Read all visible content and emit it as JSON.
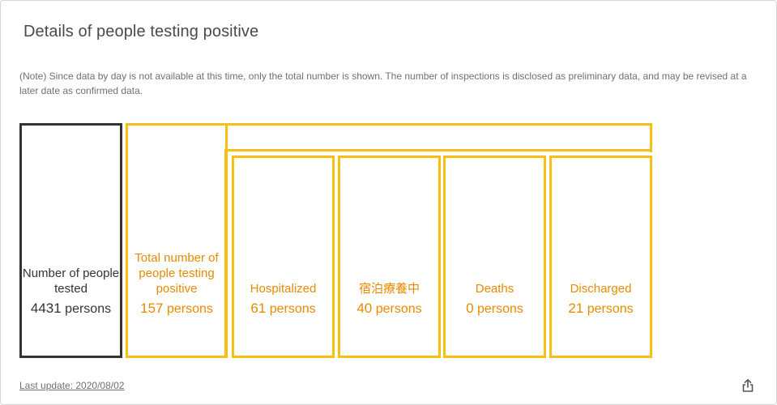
{
  "header": {
    "title": "Details of people testing positive"
  },
  "note": "(Note) Since data by day is not available at this time, only the total number is shown. The number of inspections is disclosed as preliminary data, and may be revised at a later date as confirmed data.",
  "boxes": {
    "tested": {
      "label": "Number of people tested",
      "value": "4431",
      "unit": "persons"
    },
    "total": {
      "label": "Total number of people testing positive",
      "value": "157",
      "unit": "persons"
    },
    "hospitalized": {
      "label": "Hospitalized",
      "value": "61",
      "unit": "persons"
    },
    "hotel": {
      "label": "宿泊療養中",
      "value": "40",
      "unit": "persons"
    },
    "deaths": {
      "label": "Deaths",
      "value": "0",
      "unit": "persons"
    },
    "discharged": {
      "label": "Discharged",
      "value": "21",
      "unit": "persons"
    }
  },
  "footer": {
    "last_update": "Last update: 2020/08/02"
  },
  "icons": {
    "share": "share-icon"
  },
  "colors": {
    "accent": "#f5bf13",
    "accent_text": "#e88a00",
    "dark": "#333333"
  }
}
